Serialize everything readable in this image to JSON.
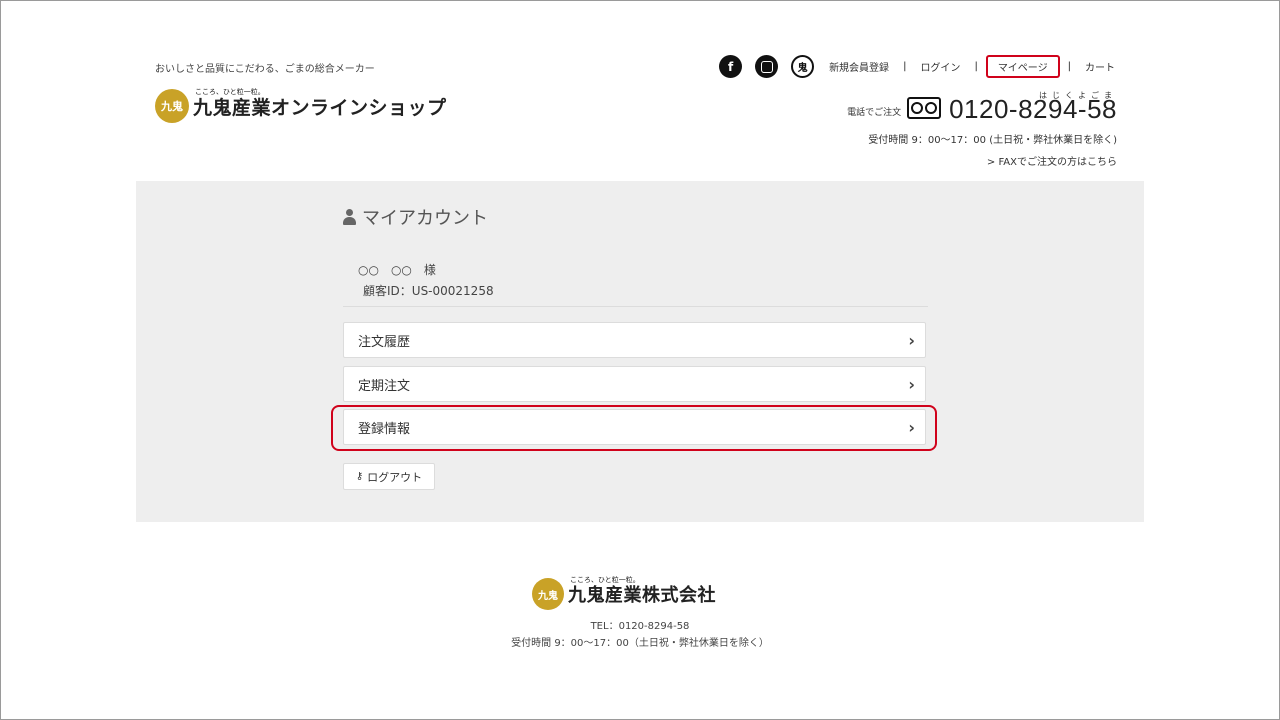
{
  "header": {
    "tagline": "おいしさと品質にこだわる、ごまの総合メーカー",
    "logo_mark": "九鬼",
    "logo_sub": "こころ、ひと粒一粒。",
    "logo_title": "九鬼産業オンラインショップ",
    "social": {
      "facebook": "f",
      "brand": "鬼"
    },
    "nav": {
      "register": "新規会員登録",
      "login": "ログイン",
      "mypage": "マイページ",
      "cart": "カート",
      "separator": "|"
    },
    "phone": {
      "label": "電話でご注文",
      "ruby": "はじくよごま",
      "number": "0120-8294-58",
      "hours": "受付時間 9：00〜17：00 (土日祝・弊社休業日を除く)",
      "fax": "> FAXでご注文の方はこちら"
    }
  },
  "account": {
    "title": "マイアカウント",
    "customer_name": "○○　○○　様",
    "customer_id": "顧客ID：US-00021258",
    "menu": [
      {
        "label": "注文履歴"
      },
      {
        "label": "定期注文"
      },
      {
        "label": "登録情報"
      }
    ],
    "chevron": "›",
    "logout": "ログアウト",
    "highlight_color": "#d0021b"
  },
  "footer": {
    "logo_mark": "九鬼",
    "logo_sub": "こころ、ひと粒一粒。",
    "logo_title": "九鬼産業株式会社",
    "tel": "TEL：0120-8294-58",
    "hours": "受付時間 9：00〜17：00（土日祝・弊社休業日を除く）"
  }
}
